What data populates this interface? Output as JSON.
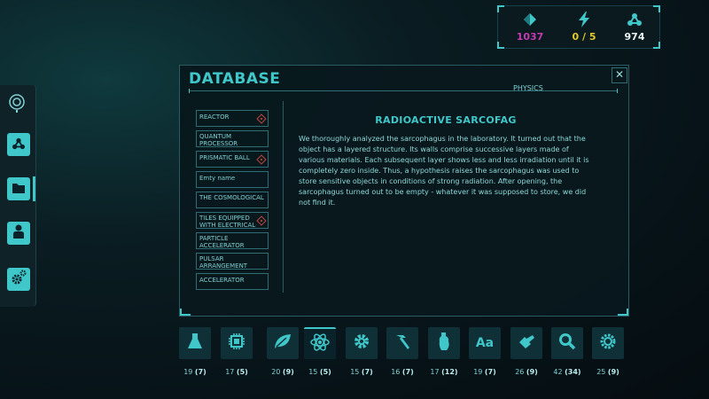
{
  "resources": [
    {
      "icon": "crystal-icon",
      "value": "1037",
      "color": "#c43bb2"
    },
    {
      "icon": "energy-bolt-icon",
      "value": "0 / 5",
      "color": "#e2c92f"
    },
    {
      "icon": "network-nodes-icon",
      "value": "974",
      "color": "#e8f4f4"
    }
  ],
  "sidebar": {
    "items": [
      {
        "name": "network",
        "icon": "network-nodes-icon"
      },
      {
        "name": "folder",
        "icon": "folder-icon",
        "active": true
      },
      {
        "name": "profile",
        "icon": "person-icon"
      },
      {
        "name": "settings",
        "icon": "gears-icon"
      }
    ]
  },
  "panel": {
    "title": "DATABASE",
    "section": "PHYSICS",
    "close_label": "✕",
    "entries": [
      {
        "label": "REACTOR",
        "warning": true
      },
      {
        "label": "QUANTUM PROCESSOR",
        "warning": false
      },
      {
        "label": "PRISMATIC BALL",
        "warning": true
      },
      {
        "label": "Emty name",
        "warning": false
      },
      {
        "label": "THE COSMOLOGICAL",
        "warning": false
      },
      {
        "label": "TILES EQUIPPED WITH ELECTRICAL",
        "warning": true
      },
      {
        "label": "PARTICLE ACCELERATOR",
        "warning": false
      },
      {
        "label": "PULSAR ARRANGEMENT",
        "warning": false
      },
      {
        "label": "ACCELERATOR",
        "warning": false
      }
    ],
    "article": {
      "title": "RADIOACTIVE SARCOFAG",
      "body": "We thoroughly analyzed the sarcophagus in the laboratory. It turned out that the object has a layered structure. Its walls comprise successive layers made of various materials. Each subsequent layer shows less and less irradiation until it is completely zero inside. Thus, a hypothesis raises the sarcophagus was used to store sensitive objects in conditions of strong radiation. After opening, the sarcophagus turned out to be empty - whatever it was supposed to store, we did not find it."
    }
  },
  "categories": [
    {
      "icon": "flask-icon",
      "total": "19",
      "new": "(7)"
    },
    {
      "icon": "chip-icon",
      "total": "17",
      "new": "(5)"
    },
    {
      "icon": "leaf-icon",
      "total": "20",
      "new": "(9)"
    },
    {
      "icon": "atom-icon",
      "total": "15",
      "new": "(5)",
      "active": true
    },
    {
      "icon": "gear-icon",
      "total": "15",
      "new": "(7)"
    },
    {
      "icon": "hammer-icon",
      "total": "16",
      "new": "(7)"
    },
    {
      "icon": "artifact-icon",
      "total": "17",
      "new": "(12)"
    },
    {
      "icon": "language-icon",
      "total": "19",
      "new": "(7)",
      "text": "Aa"
    },
    {
      "icon": "tool-icon",
      "total": "26",
      "new": "(9)"
    },
    {
      "icon": "magnifier-icon",
      "total": "42",
      "new": "(34)"
    },
    {
      "icon": "cog-icon",
      "total": "25",
      "new": "(9)"
    }
  ]
}
